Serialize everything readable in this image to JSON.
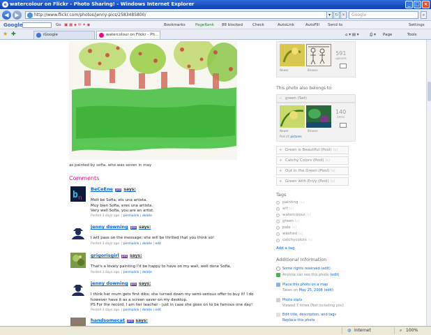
{
  "window": {
    "title": "watercolour on Flickr - Photo Sharing! - Windows Internet Explorer"
  },
  "address": {
    "url": "http://www.flickr.com/photos/jenny-pics/2583485800/",
    "search_placeholder": "Google"
  },
  "gbar": {
    "brand": "Google",
    "go": "Go",
    "bookmarks": "Bookmarks",
    "pagerank": "PageRank",
    "blocked": "88 blocked",
    "check": "Check",
    "autolink": "AutoLink",
    "autofill": "AutoFill",
    "sendto": "Send to",
    "settings": "Settings"
  },
  "tabs": [
    {
      "label": "iGoogle"
    },
    {
      "label": "watercolour on Flickr - Ph..."
    }
  ],
  "tabtools": {
    "page": "Page",
    "tools": "Tools"
  },
  "photo": {
    "caption": "as painted by sofia, who was seven in may"
  },
  "comments": {
    "heading": "Comments",
    "items": [
      {
        "name": "BeCeEne",
        "pro": "pro",
        "says": "says:",
        "lines": [
          "Molt bé Sofia, ets una artista.",
          "Muy bien Sofia, eres una artista.",
          "Very well Sofia, you are an artist."
        ],
        "posted": "Posted 3 days ago.",
        "links": [
          "permalink",
          "delete"
        ]
      },
      {
        "name": "jenny downing",
        "pro": "pro",
        "says": "says:",
        "lines": [
          "I will pass on the message; she will be thrilled that you think so!"
        ],
        "posted": "Posted 3 days ago.",
        "links": [
          "permalink",
          "delete",
          "edit"
        ]
      },
      {
        "name": "grigorisgirl",
        "pro": "pro",
        "says": "says:",
        "lines": [
          "That's a lovely painting I'd be happy to have on my wall, well done Sofia."
        ],
        "posted": "Posted 3 days ago.",
        "links": [
          "permalink",
          "delete"
        ]
      },
      {
        "name": "jenny downing",
        "pro": "pro",
        "says": "says:",
        "lines": [
          "I think her mum gets first dibs; she turned down my semi-serious offer to buy it! I do",
          "however have it as a screen saver on my desktop.",
          "PS For the record, I am her teacher - just in case she goes on to be famous one day!"
        ],
        "posted": "Posted 3 days ago.",
        "links": [
          "permalink",
          "delete",
          "edit"
        ]
      },
      {
        "name": "handsomecat",
        "pro": "pro",
        "says": "says:",
        "lines": [],
        "posted": "",
        "links": []
      }
    ]
  },
  "sidebar": {
    "top_set": {
      "count": "591",
      "count_label": "uploads",
      "labels": [
        "Newer",
        "Browse"
      ]
    },
    "belongs_heading": "This photo also belongs to:",
    "set": {
      "name": "green (Set)",
      "count": "140",
      "count_label": "items",
      "labels": [
        "Newer",
        "Browse"
      ],
      "part_of": "Part of:",
      "part_of_link": "pictures"
    },
    "pools": [
      "Green is Beautiful (Pool)",
      "Catchy Colors (Pool)",
      "Out in the Green (Pool)",
      "Green with Envy (Pool)"
    ],
    "pool_remove": "[x]",
    "tags_heading": "Tags",
    "tags": [
      "painting",
      "art",
      "watercolour",
      "green",
      "pale",
      "washed",
      "catchycolors"
    ],
    "add_tag": "Add a tag",
    "info_heading": "Additional Information",
    "info": {
      "rights": "Some rights reserved",
      "rights_edit": "(edit)",
      "visibility": "Anyone can see this photo",
      "visibility_edit": "(edit)",
      "map": "Place this photo on a map",
      "taken_prefix": "Taken on",
      "taken_date": "May 25, 2008",
      "taken_edit": "(edit)",
      "stats": "Photo stats",
      "viewed": "Viewed 7 times",
      "viewed_note": "(Not including you)",
      "edit": "Edit title, description, and tags",
      "replace": "Replace this photo"
    }
  },
  "status": {
    "zone": "Internet",
    "zoom": "100%"
  },
  "colors": {
    "link": "#0063dc",
    "comments_heading": "#ff0084",
    "pro_badge": "#7b4ea8",
    "titlebar": "#0a3fb0"
  }
}
